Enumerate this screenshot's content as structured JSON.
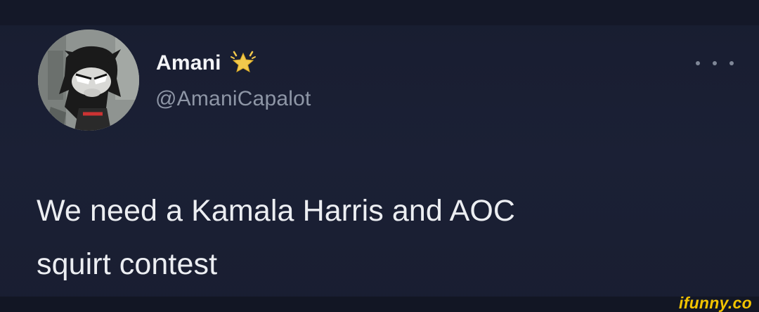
{
  "tweet": {
    "author": {
      "display_name": "Amani",
      "handle": "@AmaniCapalot",
      "badge_icon": "sparkle-star-icon",
      "avatar_icon": "cartoon-echidna-avatar"
    },
    "more_icon": "more-horizontal-icon",
    "text_line_1": "We need a Kamala Harris and AOC",
    "text_line_2": "squirt contest"
  },
  "watermark": {
    "text": "ifunny.co"
  },
  "colors": {
    "background": "#1b2035",
    "name": "#f3f4f7",
    "handle": "#8e96a6",
    "body_text": "#eceef2",
    "badge": "#f2c94c",
    "watermark": "#f2c300"
  }
}
